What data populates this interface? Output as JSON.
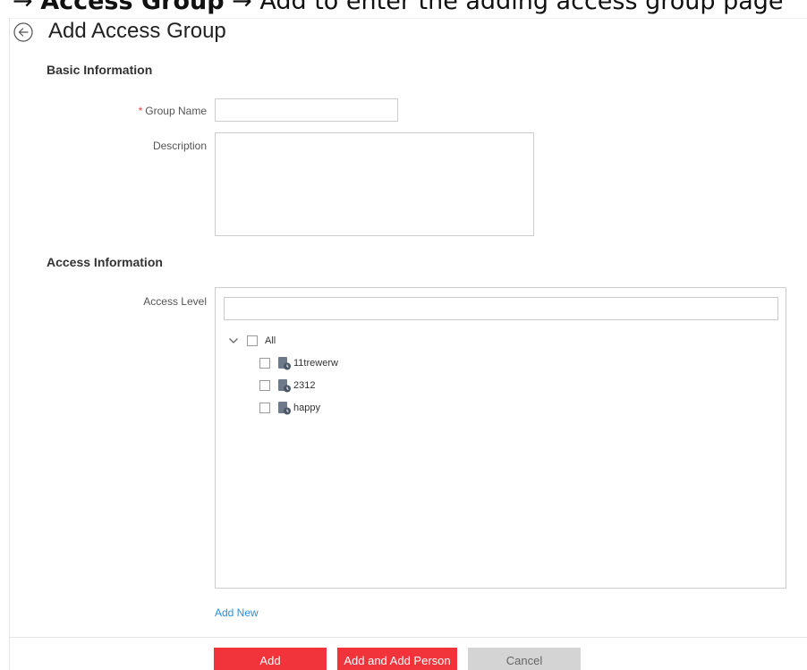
{
  "caption": {
    "bold_part": "Access Group",
    "rest": " → Add to enter the adding access group page"
  },
  "header": {
    "back_icon": "back-arrow-circle-icon",
    "title": "Add Access Group"
  },
  "basic_info": {
    "section_title": "Basic Information",
    "group_name": {
      "required_mark": "*",
      "label": "Group Name",
      "value": "",
      "placeholder": ""
    },
    "description": {
      "label": "Description",
      "value": "",
      "placeholder": ""
    }
  },
  "access_info": {
    "section_title": "Access Information",
    "access_level_label": "Access Level",
    "search": {
      "value": "",
      "placeholder": ""
    },
    "tree": {
      "root": {
        "label": "All",
        "expanded": true,
        "checked": false,
        "expander_icon": "chevron-down-icon"
      },
      "items": [
        {
          "label": "11trewerw",
          "checked": false,
          "icon": "access-level-icon"
        },
        {
          "label": "2312",
          "checked": false,
          "icon": "access-level-icon"
        },
        {
          "label": "happy",
          "checked": false,
          "icon": "access-level-icon"
        }
      ]
    },
    "add_new_label": "Add New"
  },
  "footer": {
    "add_label": "Add",
    "add_and_add_person_label": "Add and Add Person",
    "cancel_label": "Cancel"
  },
  "colors": {
    "primary_button": "#f1333b",
    "cancel_button": "#d4d4d4",
    "link": "#2a8fe0",
    "required_mark": "#e84040"
  }
}
